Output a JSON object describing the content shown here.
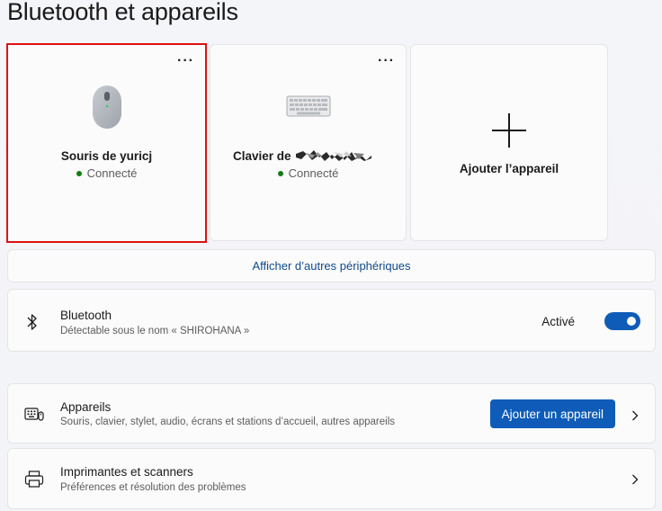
{
  "page": {
    "title": "Bluetooth et appareils"
  },
  "devices": [
    {
      "name": "Souris de yuricj",
      "status": "Connecté",
      "icon": "mouse-icon"
    },
    {
      "name": "Clavier de",
      "status": "Connecté",
      "icon": "keyboard-icon"
    }
  ],
  "add_device_card": {
    "label": "Ajouter l’appareil",
    "icon": "plus-icon"
  },
  "more_devices_link": "Afficher d’autres périphériques",
  "bluetooth": {
    "title": "Bluetooth",
    "subtitle": "Détectable sous le nom « SHIROHANA »",
    "toggle_label": "Activé",
    "toggle_on": true
  },
  "devices_row": {
    "title": "Appareils",
    "subtitle": "Souris, clavier, stylet, audio, écrans et stations d’accueil, autres appareils",
    "button_label": "Ajouter un appareil"
  },
  "printers_row": {
    "title": "Imprimantes et scanners",
    "subtitle": "Préférences et résolution des problèmes"
  },
  "colors": {
    "accent": "#0f5cb8",
    "connected": "#107c10",
    "selection": "#e01010"
  }
}
